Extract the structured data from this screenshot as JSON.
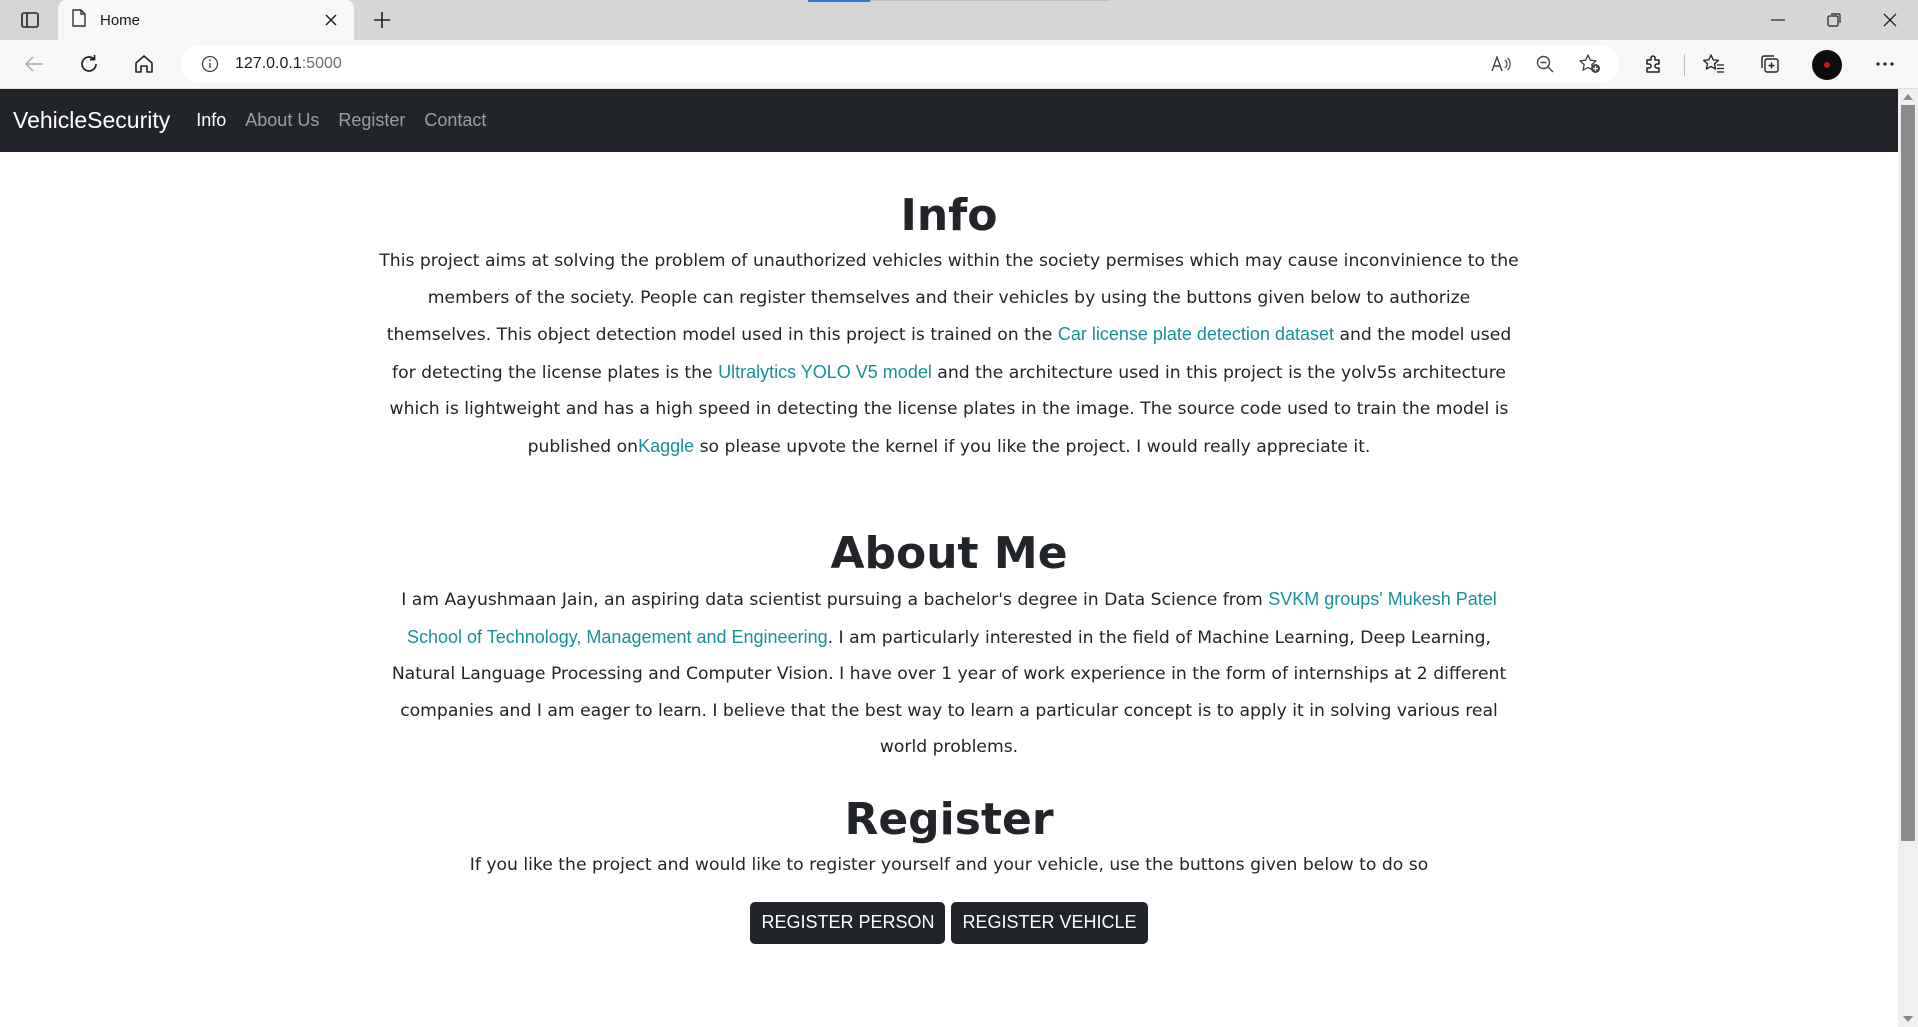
{
  "browser": {
    "tab_title": "Home",
    "url_host": "127.0.0.1",
    "url_port": ":5000"
  },
  "navbar": {
    "brand": "VehicleSecurity",
    "links": [
      "Info",
      "About Us",
      "Register",
      "Contact"
    ],
    "active": "Info"
  },
  "info": {
    "heading": "Info",
    "text_1": "This project aims at solving the problem of unauthorized vehicles within the society permises which may cause inconvinience to the members of the society. People can register themselves and their vehicles by using the buttons given below to authorize themselves. This object detection model used in this project is trained on the ",
    "link_dataset": "Car license plate detection dataset",
    "text_2": " and the model used for detecting the license plates is the ",
    "link_model": "Ultralytics YOLO V5 model",
    "text_3": " and the architecture used in this project is the yolv5s architecture which is lightweight and has a high speed in detecting the license plates in the image. The source code used to train the model is published on",
    "link_kaggle": "Kaggle",
    "text_4": " so please upvote the kernel if you like the project. I would really appreciate it."
  },
  "about": {
    "heading": "About Me",
    "text_1": "I am Aayushmaan Jain, an aspiring data scientist pursuing a bachelor's degree in Data Science from ",
    "link_school": "SVKM groups' Mukesh Patel School of Technology, Management and Engineering",
    "text_2": ". I am particularly interested in the field of Machine Learning, Deep Learning, Natural Language Processing and Computer Vision. I have over 1 year of work experience in the form of internships at 2 different companies and I am eager to learn. I believe that the best way to learn a particular concept is to apply it in solving various real world problems."
  },
  "register": {
    "heading": "Register",
    "text": "If you like the project and would like to register yourself and your vehicle, use the buttons given below to do so",
    "btn_person": "REGISTER PERSON",
    "btn_vehicle": "REGISTER VEHICLE"
  },
  "colors": {
    "navbar_bg": "#212529",
    "link": "#1b8f96",
    "button_bg": "#212529"
  },
  "icons": [
    "tab-actions-icon",
    "page-icon",
    "close-icon",
    "plus-icon",
    "minimize-icon",
    "restore-icon",
    "window-close-icon",
    "back-arrow-icon",
    "refresh-icon",
    "home-icon",
    "info-icon",
    "read-aloud-icon",
    "zoom-out-icon",
    "add-favorite-icon",
    "extensions-icon",
    "favorites-icon",
    "collections-icon",
    "more-icon"
  ]
}
